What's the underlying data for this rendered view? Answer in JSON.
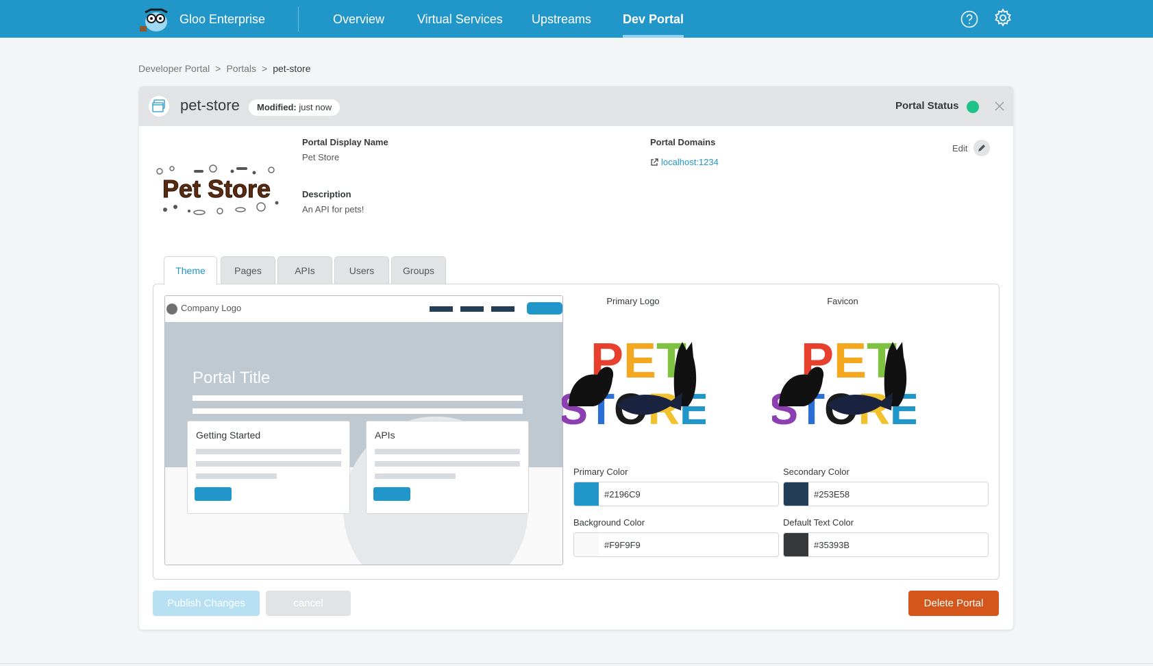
{
  "app": {
    "brand_name": "Gloo Enterprise",
    "accent_color": "#2196C9"
  },
  "nav": {
    "items": [
      {
        "label": "Overview",
        "active": false
      },
      {
        "label": "Virtual Services",
        "active": false
      },
      {
        "label": "Upstreams",
        "active": false
      },
      {
        "label": "Dev Portal",
        "active": true
      }
    ],
    "help_icon": "help-circle-icon",
    "settings_icon": "gear-icon"
  },
  "breadcrumb": {
    "items": [
      "Developer Portal",
      "Portals",
      "pet-store"
    ],
    "separator": ">"
  },
  "portal": {
    "name": "pet-store",
    "modified_label": "Modified:",
    "modified_value": "just now",
    "status_label": "Portal Status",
    "status_color": "#1EC487",
    "display_name_label": "Portal Display Name",
    "display_name": "Pet Store",
    "description_label": "Description",
    "description": "An API for pets!",
    "domains_label": "Portal Domains",
    "domain": "localhost:1234",
    "edit_label": "Edit",
    "hero_logo_text": "Pet Store"
  },
  "tabs": [
    {
      "label": "Theme",
      "active": true
    },
    {
      "label": "Pages",
      "active": false
    },
    {
      "label": "APIs",
      "active": false
    },
    {
      "label": "Users",
      "active": false
    },
    {
      "label": "Groups",
      "active": false
    }
  ],
  "theme": {
    "preview": {
      "company_logo": "Company Logo",
      "portal_title": "Portal Title",
      "cards": [
        "Getting Started",
        "APIs"
      ]
    },
    "primary_logo_label": "Primary Logo",
    "favicon_label": "Favicon",
    "logo_text": [
      "PET",
      "STORE"
    ],
    "colors": {
      "primary": {
        "label": "Primary Color",
        "value": "#2196C9"
      },
      "secondary": {
        "label": "Secondary Color",
        "value": "#253E58"
      },
      "background": {
        "label": "Background Color",
        "value": "#F9F9F9"
      },
      "text": {
        "label": "Default Text Color",
        "value": "#35393B"
      }
    }
  },
  "actions": {
    "publish": "Publish Changes",
    "cancel": "cancel",
    "delete": "Delete Portal",
    "delete_color": "#D5561A"
  }
}
